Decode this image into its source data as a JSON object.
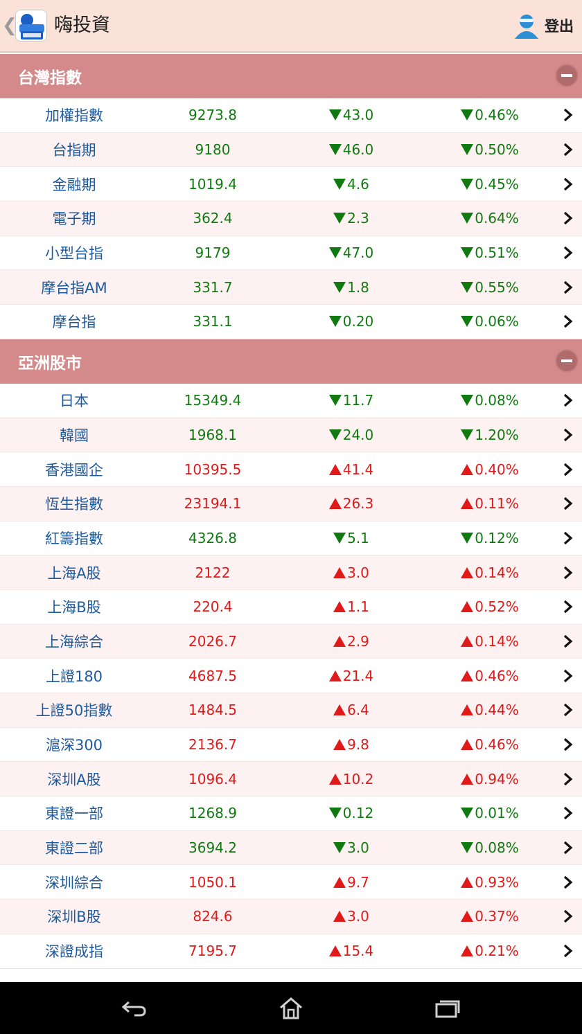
{
  "app": {
    "title": "嗨投資",
    "logout_label": "登出"
  },
  "sections": [
    {
      "title": "台灣指數",
      "rows": [
        {
          "name": "加權指數",
          "price": "9273.8",
          "change": "43.0",
          "pct": "0.46%",
          "dir": "down"
        },
        {
          "name": "台指期",
          "price": "9180",
          "change": "46.0",
          "pct": "0.50%",
          "dir": "down"
        },
        {
          "name": "金融期",
          "price": "1019.4",
          "change": "4.6",
          "pct": "0.45%",
          "dir": "down"
        },
        {
          "name": "電子期",
          "price": "362.4",
          "change": "2.3",
          "pct": "0.64%",
          "dir": "down"
        },
        {
          "name": "小型台指",
          "price": "9179",
          "change": "47.0",
          "pct": "0.51%",
          "dir": "down"
        },
        {
          "name": "摩台指AM",
          "price": "331.7",
          "change": "1.8",
          "pct": "0.55%",
          "dir": "down"
        },
        {
          "name": "摩台指",
          "price": "331.1",
          "change": "0.20",
          "pct": "0.06%",
          "dir": "down"
        }
      ]
    },
    {
      "title": "亞洲股市",
      "rows": [
        {
          "name": "日本",
          "price": "15349.4",
          "change": "11.7",
          "pct": "0.08%",
          "dir": "down"
        },
        {
          "name": "韓國",
          "price": "1968.1",
          "change": "24.0",
          "pct": "1.20%",
          "dir": "down"
        },
        {
          "name": "香港國企",
          "price": "10395.5",
          "change": "41.4",
          "pct": "0.40%",
          "dir": "up"
        },
        {
          "name": "恆生指數",
          "price": "23194.1",
          "change": "26.3",
          "pct": "0.11%",
          "dir": "up"
        },
        {
          "name": "紅籌指數",
          "price": "4326.8",
          "change": "5.1",
          "pct": "0.12%",
          "dir": "down"
        },
        {
          "name": "上海A股",
          "price": "2122",
          "change": "3.0",
          "pct": "0.14%",
          "dir": "up"
        },
        {
          "name": "上海B股",
          "price": "220.4",
          "change": "1.1",
          "pct": "0.52%",
          "dir": "up"
        },
        {
          "name": "上海綜合",
          "price": "2026.7",
          "change": "2.9",
          "pct": "0.14%",
          "dir": "up"
        },
        {
          "name": "上證180",
          "price": "4687.5",
          "change": "21.4",
          "pct": "0.46%",
          "dir": "up"
        },
        {
          "name": "上證50指數",
          "price": "1484.5",
          "change": "6.4",
          "pct": "0.44%",
          "dir": "up"
        },
        {
          "name": "滬深300",
          "price": "2136.7",
          "change": "9.8",
          "pct": "0.46%",
          "dir": "up"
        },
        {
          "name": "深圳A股",
          "price": "1096.4",
          "change": "10.2",
          "pct": "0.94%",
          "dir": "up"
        },
        {
          "name": "東證一部",
          "price": "1268.9",
          "change": "0.12",
          "pct": "0.01%",
          "dir": "down"
        },
        {
          "name": "東證二部",
          "price": "3694.2",
          "change": "3.0",
          "pct": "0.08%",
          "dir": "down"
        },
        {
          "name": "深圳綜合",
          "price": "1050.1",
          "change": "9.7",
          "pct": "0.93%",
          "dir": "up"
        },
        {
          "name": "深圳B股",
          "price": "824.6",
          "change": "3.0",
          "pct": "0.37%",
          "dir": "up"
        },
        {
          "name": "深證成指",
          "price": "7195.7",
          "change": "15.4",
          "pct": "0.21%",
          "dir": "up"
        }
      ]
    }
  ],
  "colors": {
    "up": "#e01919",
    "down": "#107a10",
    "name": "#1d5a9e",
    "section_header": "#d48a8a",
    "app_bar": "#fbe2d9"
  },
  "icons": {
    "back": "chevron-left-icon",
    "user": "user-avatar-icon",
    "collapse": "minus-circle-icon",
    "row_arrow": "chevron-right-icon",
    "nav_back": "back-arrow-icon",
    "nav_home": "home-icon",
    "nav_recent": "recent-apps-icon"
  }
}
